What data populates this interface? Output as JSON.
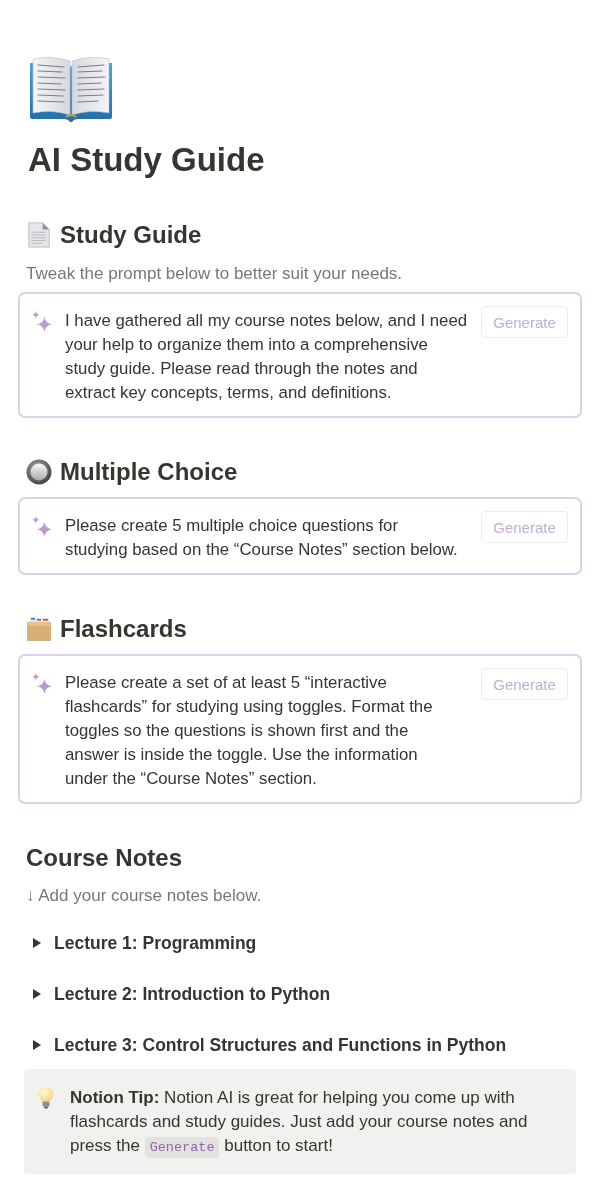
{
  "header": {
    "title": "AI Study Guide"
  },
  "sections": [
    {
      "heading": "Study Guide",
      "description": "Tweak the prompt below to better suit your needs.",
      "prompt": {
        "text": "I have gathered all my course notes below, and I need\nyour help to organize them into a comprehensive\nstudy guide. Please read through the notes and\nextract key concepts, terms, and definitions.",
        "button": "Generate"
      }
    },
    {
      "heading": "Multiple Choice",
      "prompt": {
        "text": "Please create 5 multiple choice questions for\nstudying based on the “Course Notes” section below.",
        "button": "Generate"
      }
    },
    {
      "heading": "Flashcards",
      "prompt": {
        "text": "Please create a set of at least 5 “interactive\nflashcards” for studying using toggles. Format the\ntoggles so the questions is shown first and the\nanswer is inside the toggle. Use the information\nunder the “Course Notes” section.",
        "button": "Generate"
      }
    }
  ],
  "course_notes": {
    "heading": "Course Notes",
    "hint": "↓ Add your course notes below.",
    "toggles": [
      {
        "label": "Lecture 1: Programming",
        "expanded": false
      },
      {
        "label": "Lecture 2: Introduction to Python",
        "expanded": false
      },
      {
        "label": "Lecture 3: Control Structures and Functions in Python",
        "expanded": false
      }
    ]
  },
  "callout": {
    "text": "**Notion Tip:** Notion AI is great for helping you come up with flashcards and study guides. Just add your course notes and press the",
    "code": "Generate",
    "text_end": "button to start!"
  }
}
